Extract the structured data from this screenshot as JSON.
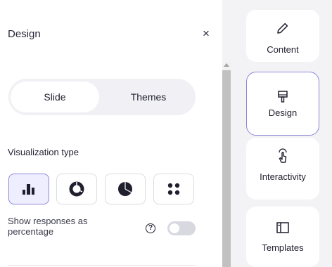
{
  "panel": {
    "title": "Design",
    "close_label": "×",
    "tabs": [
      {
        "label": "Slide",
        "active": true
      },
      {
        "label": "Themes",
        "active": false
      }
    ],
    "visualization": {
      "label": "Visualization type",
      "options": [
        {
          "icon": "bar-chart-icon",
          "selected": true
        },
        {
          "icon": "donut-chart-icon",
          "selected": false
        },
        {
          "icon": "pie-chart-icon",
          "selected": false
        },
        {
          "icon": "dots-grid-icon",
          "selected": false
        }
      ]
    },
    "percentage_toggle": {
      "label": "Show responses as percentage",
      "help_glyph": "?",
      "enabled": false
    }
  },
  "rail": [
    {
      "label": "Content",
      "icon": "pencil-icon",
      "active": false
    },
    {
      "label": "Design",
      "icon": "paint-brush-icon",
      "active": true
    },
    {
      "label": "Interactivity",
      "icon": "hand-pointer-icon",
      "active": false
    },
    {
      "label": "Templates",
      "icon": "layout-template-icon",
      "active": false
    }
  ],
  "colors": {
    "accent_border": "#8b86d8",
    "accent_fill": "#efeeff",
    "icon_dark": "#1f1f2e",
    "background": "#f3f3f6"
  }
}
